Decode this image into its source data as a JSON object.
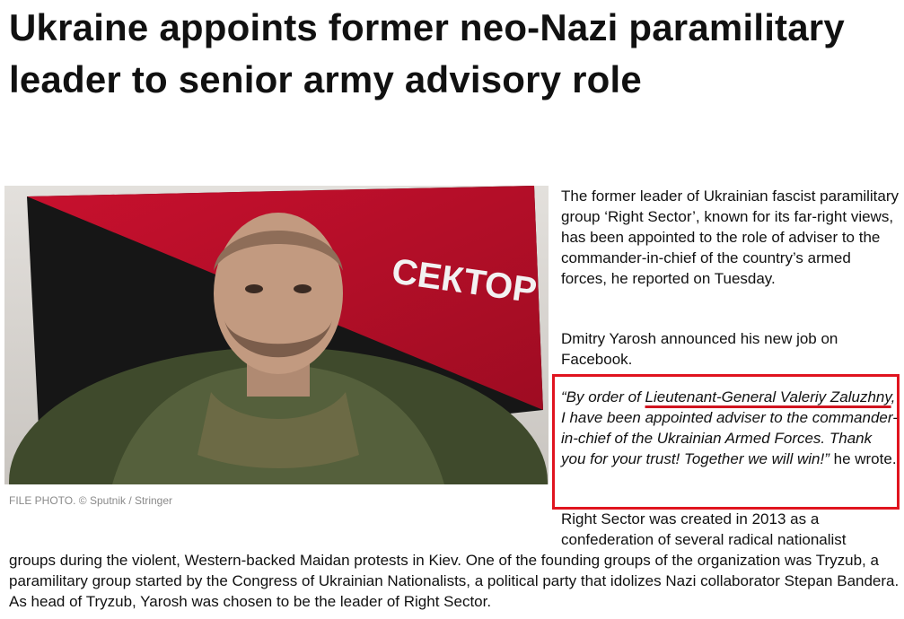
{
  "article": {
    "headline": "Ukraine appoints former neo-Nazi paramilitary leader to senior army advisory role",
    "photo": {
      "flag_text": "СЕКТОР",
      "caption": "FILE PHOTO. © Sputnik / Stringer",
      "colors": {
        "flag_red": "#c8102e",
        "flag_black": "#1a1a1a"
      }
    },
    "paragraphs": {
      "p1": "The former leader of Ukrainian fascist paramilitary group ‘Right Sector’, known for its far-right views, has been appointed to the role of adviser to the commander-in-chief of the country’s armed forces, he reported on Tuesday.",
      "p2": "Dmitry Yarosh announced his new job on Facebook.",
      "p3": "Right Sector was created in 2013 as a confederation of several radical nationalist",
      "p4": "groups during the violent, Western-backed Maidan protests in Kiev. One of the founding groups of the organization was Tryzub, a paramilitary group started by the Congress of Ukrainian Nationalists, a political party that idolizes Nazi collaborator Stepan Bandera. As head of Tryzub, Yarosh was chosen to be the leader of Right Sector."
    },
    "quote": {
      "lead": "“By order of ",
      "highlight": "Lieutenant-General Valeriy Zaluzhny",
      "rest": ", I have been appointed adviser to the commander-in-chief of the Ukrainian Armed Forces. Thank you for your trust! Together we will win!”",
      "attribution": " he wrote."
    },
    "annotation_color": "#e0141f"
  }
}
